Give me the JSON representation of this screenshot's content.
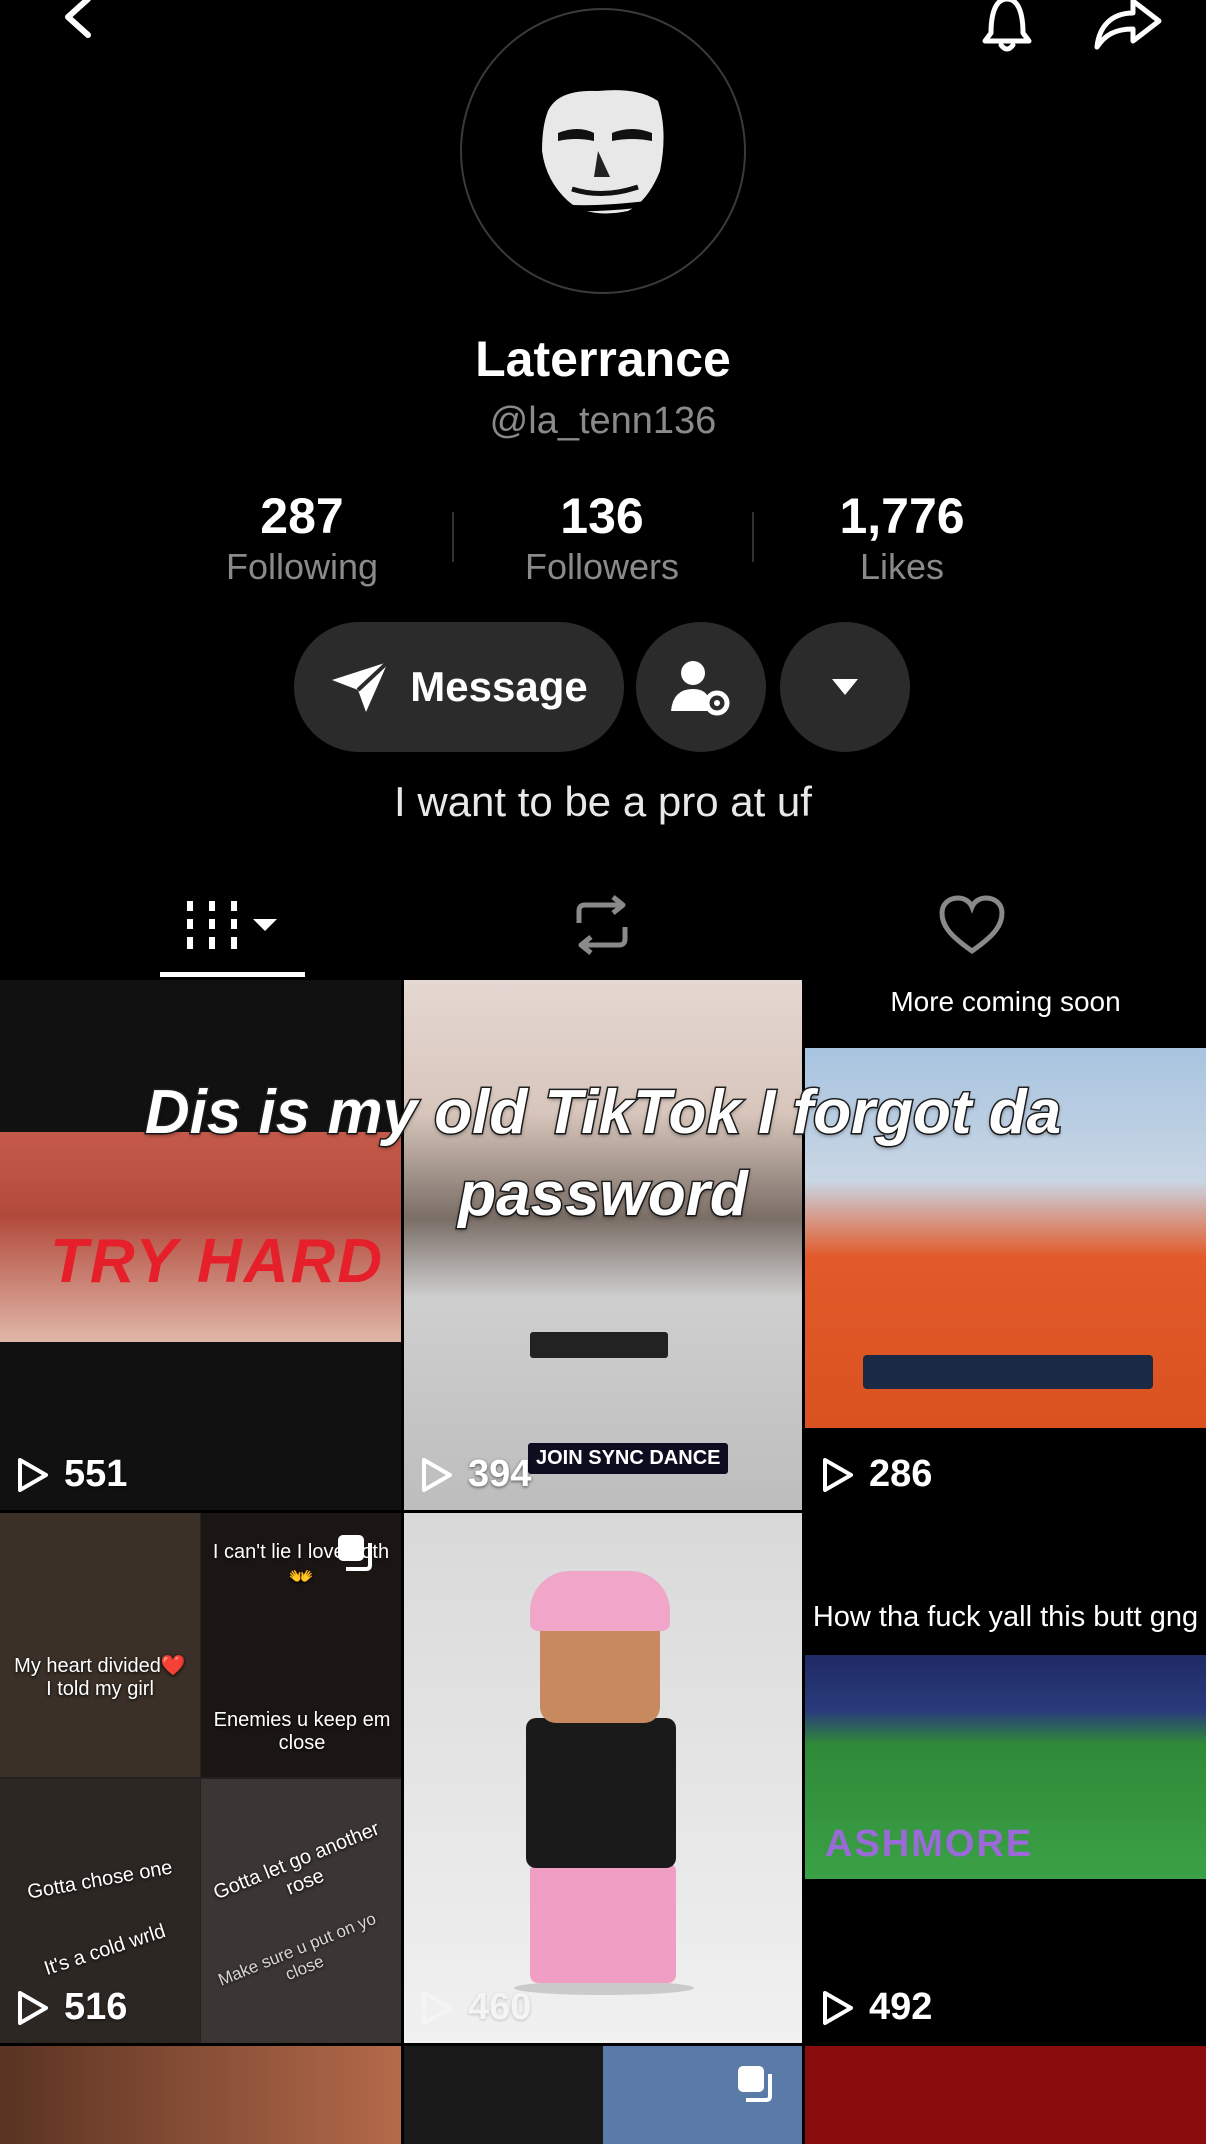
{
  "profile": {
    "display_name": "Laterrance",
    "handle": "@la_tenn136",
    "bio": "I want to be a pro at uf"
  },
  "stats": [
    {
      "value": "287",
      "label": "Following"
    },
    {
      "value": "136",
      "label": "Followers"
    },
    {
      "value": "1,776",
      "label": "Likes"
    }
  ],
  "actions": {
    "message_label": "Message"
  },
  "icons": {
    "back": "chevron-left-icon",
    "notifications": "bell-icon",
    "share": "share-arrow-icon",
    "message": "send-icon",
    "friend_settings": "user-gear-icon",
    "more": "caret-down-icon",
    "videos_tab": "grid-icon",
    "reposts_tab": "repost-icon",
    "liked_tab": "heart-icon",
    "views": "play-icon"
  },
  "overlay_caption": "Dis is my old TikTok I forgot da password",
  "videos": [
    {
      "views": "551",
      "thumb_text": "TRY HARD"
    },
    {
      "views": "394",
      "thumb_text": "JOIN SYNC DANCE"
    },
    {
      "views": "286",
      "thumb_text": "More coming soon"
    },
    {
      "views": "516",
      "thumb_texts": [
        "My heart divided❤️ I told my girl",
        "I can't lie I love both👐",
        "Enemies u keep em close",
        "Gotta chose one",
        "It's a cold wrld",
        "Gotta let go another rose",
        "Make sure u put on yo close"
      ]
    },
    {
      "views": "460"
    },
    {
      "views": "492",
      "thumb_text": "How tha fuck yall this butt gng",
      "thumb_text_2": "ASHMORE"
    }
  ],
  "colors": {
    "background": "#000000",
    "button_bg": "#2b2b2b",
    "secondary_text": "#8a8a8a"
  }
}
